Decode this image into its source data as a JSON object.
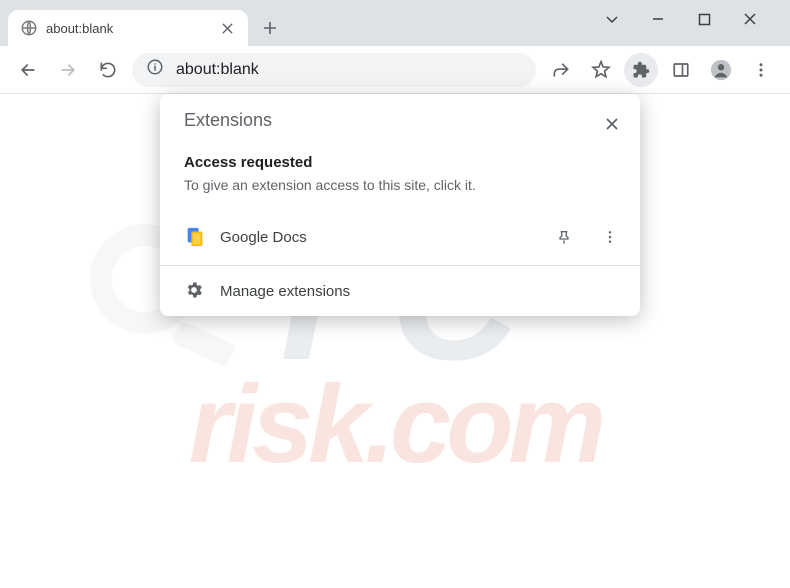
{
  "window": {
    "tab_title": "about:blank"
  },
  "toolbar": {
    "url": "about:blank"
  },
  "popup": {
    "title": "Extensions",
    "section_heading": "Access requested",
    "section_desc": "To give an extension access to this site, click it.",
    "extension_name": "Google Docs",
    "manage_label": "Manage extensions"
  },
  "watermark": {
    "line1": "PC",
    "line2": "risk.com"
  }
}
